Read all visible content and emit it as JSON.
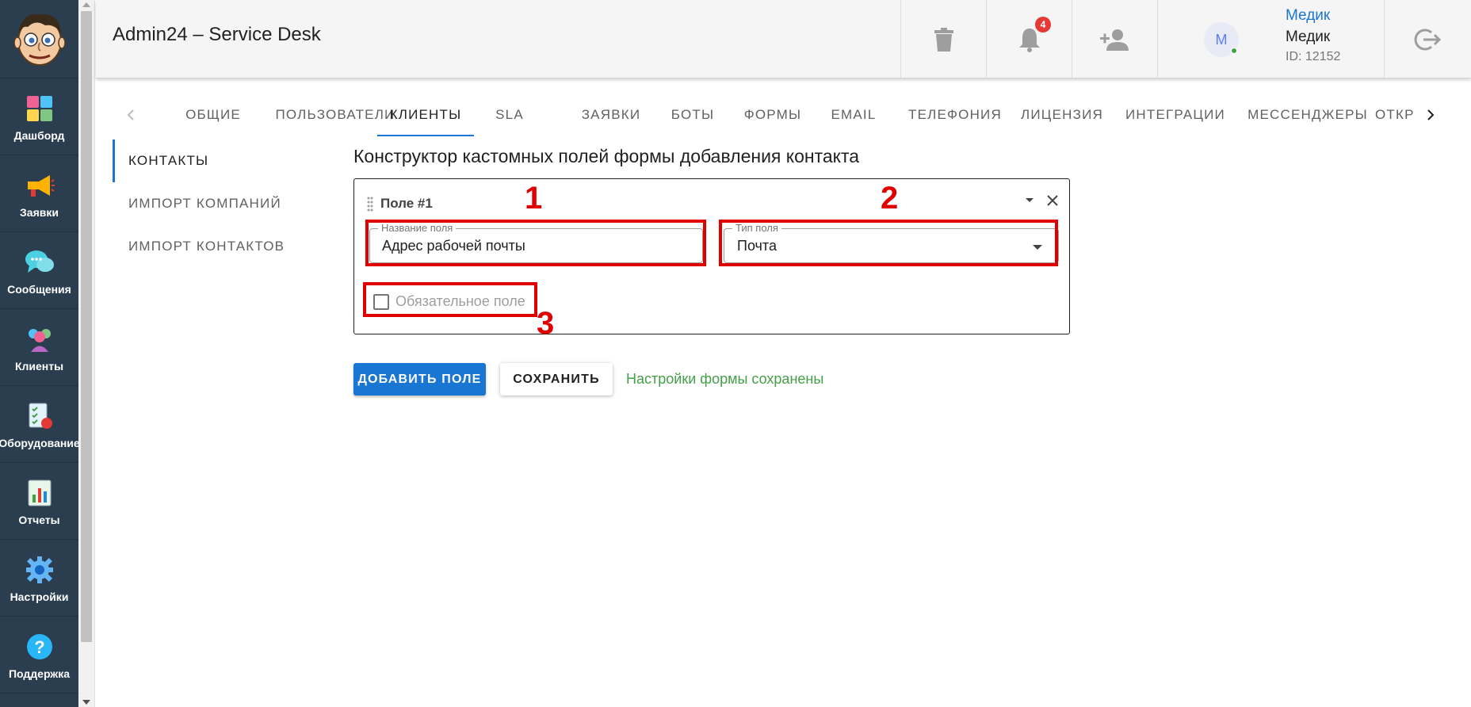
{
  "app": {
    "title": "Admin24 – Service Desk"
  },
  "sidebar": {
    "items": [
      {
        "label": "Дашборд",
        "icon": "dashboard-icon"
      },
      {
        "label": "Заявки",
        "icon": "megaphone-icon"
      },
      {
        "label": "Сообщения",
        "icon": "chat-bubbles-icon"
      },
      {
        "label": "Клиенты",
        "icon": "clients-icon"
      },
      {
        "label": "Оборудование",
        "icon": "equipment-checklist-icon"
      },
      {
        "label": "Отчеты",
        "icon": "reports-chart-icon"
      },
      {
        "label": "Настройки",
        "icon": "gear-icon"
      },
      {
        "label": "Поддержка",
        "icon": "help-question-icon"
      }
    ]
  },
  "header": {
    "notifications_count": "4",
    "user": {
      "avatar_letter": "М",
      "link_name": "Медик",
      "name": "Медик",
      "id": "ID: 12152"
    }
  },
  "tabs": [
    "ОБЩИЕ",
    "ПОЛЬЗОВАТЕЛИ",
    "КЛИЕНТЫ",
    "SLA",
    "ЗАЯВКИ",
    "БОТЫ",
    "ФОРМЫ",
    "EMAIL",
    "ТЕЛЕФОНИЯ",
    "ЛИЦЕНЗИЯ",
    "ИНТЕГРАЦИИ",
    "МЕССЕНДЖЕРЫ",
    "ОТКР"
  ],
  "active_tab": "КЛИЕНТЫ",
  "subnav": [
    "КОНТАКТЫ",
    "ИМПОРТ КОМПАНИЙ",
    "ИМПОРТ КОНТАКТОВ"
  ],
  "main": {
    "title": "Конструктор кастомных полей формы добавления контакта",
    "field_card": {
      "title": "Поле #1",
      "name_label": "Название поля",
      "name_value": "Адрес рабочей почты",
      "type_label": "Тип поля",
      "type_value": "Почта",
      "required_label": "Обязательное поле",
      "required_checked": false
    },
    "add_button": "ДОБАВИТЬ ПОЛЕ",
    "save_button": "СОХРАНИТЬ",
    "status_message": "Настройки формы сохранены"
  },
  "annotations": [
    "1",
    "2",
    "3"
  ],
  "colors": {
    "sidebar": "#2b3e50",
    "accent": "#1976d2",
    "annotation": "#e10000",
    "success": "#43a047"
  }
}
